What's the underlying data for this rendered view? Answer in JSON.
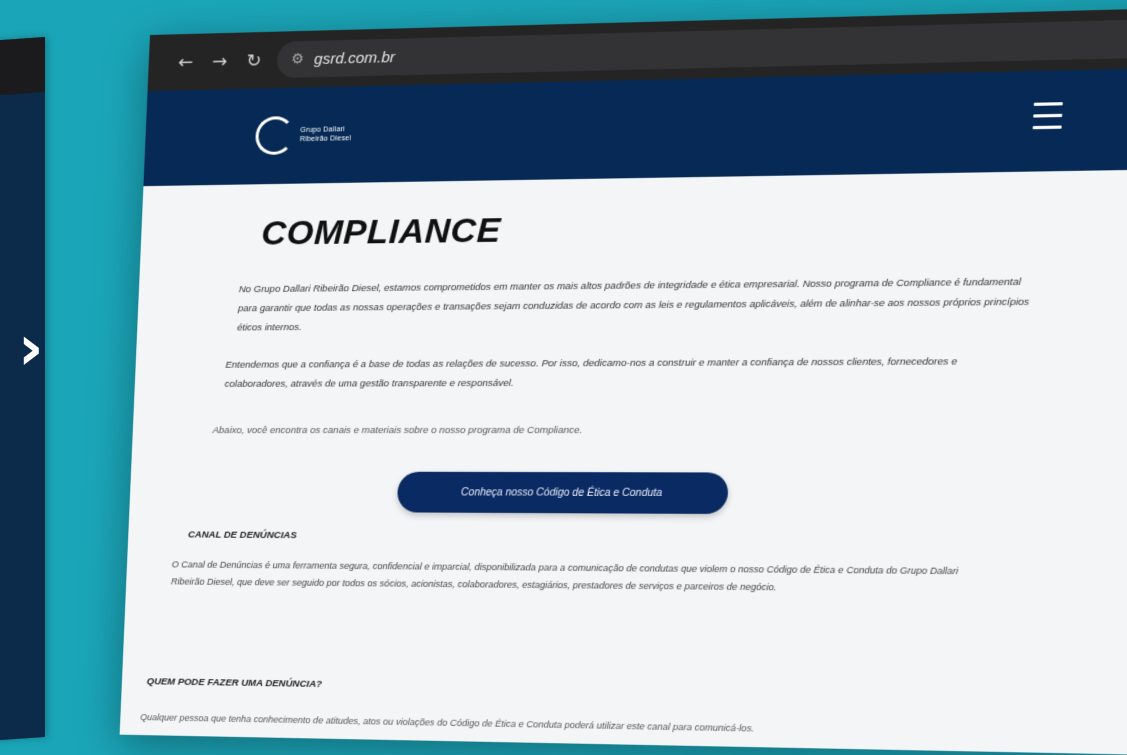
{
  "browser": {
    "url": "gsrd.com.br",
    "back_icon": "←",
    "forward_icon": "→",
    "reload_icon": "↻",
    "site_info_icon": "⚙",
    "bookmark_icon": "☆"
  },
  "site": {
    "logo_text_line1": "Grupo Dallari",
    "logo_text_line2": "Ribeirão Diesel"
  },
  "page": {
    "title": "COMPLIANCE",
    "paragraph1": "No Grupo Dallari Ribeirão Diesel, estamos comprometidos em manter os mais altos padrões de integridade e ética empresarial. Nosso programa de Compliance é fundamental para garantir que todas as nossas operações e transações sejam conduzidas de acordo com as leis e regulamentos aplicáveis, além de alinhar-se aos nossos próprios princípios éticos internos.",
    "paragraph2": "Entendemos que a confiança é a base de todas as relações de sucesso. Por isso, dedicamo-nos a construir e manter a confiança de nossos clientes, fornecedores e colaboradores, através de uma gestão transparente e responsável.",
    "paragraph3": "Abaixo, você encontra os canais e materiais sobre o nosso programa de Compliance.",
    "cta_label": "Conheça nosso Código de Ética e Conduta",
    "section1_title": "CANAL DE DENÚNCIAS",
    "section1_text": "O Canal de Denúncias é uma ferramenta segura, confidencial e imparcial, disponibilizada para a comunicação de condutas que violem o nosso Código de Ética e Conduta do Grupo Dallari Ribeirão Diesel, que deve ser seguido por todos os sócios, acionistas, colaboradores, estagiários, prestadores de serviços e parceiros de negócio.",
    "section2_title": "QUEM PODE FAZER UMA DENÚNCIA?",
    "section2_text": "Qualquer pessoa que tenha conhecimento de atitudes, atos ou violações do Código de Ética e Conduta poderá utilizar este canal para comunicá-los."
  }
}
